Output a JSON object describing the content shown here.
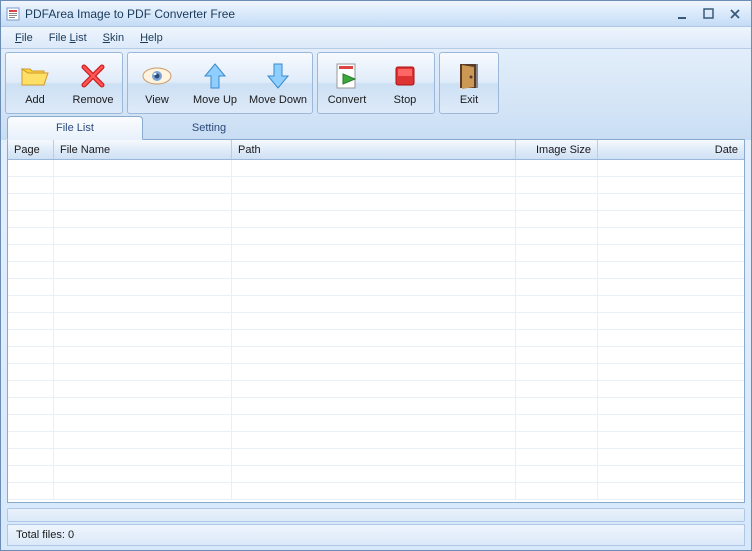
{
  "window": {
    "title": "PDFArea Image to PDF Converter Free"
  },
  "menu": {
    "file": "File",
    "filelist": "File List",
    "skin": "Skin",
    "help": "Help"
  },
  "toolbar": {
    "add": "Add",
    "remove": "Remove",
    "view": "View",
    "moveup": "Move Up",
    "movedown": "Move Down",
    "convert": "Convert",
    "stop": "Stop",
    "exit": "Exit"
  },
  "tabs": {
    "filelist": "File List",
    "setting": "Setting"
  },
  "columns": {
    "page": "Page",
    "filename": "File Name",
    "path": "Path",
    "imagesize": "Image Size",
    "date": "Date"
  },
  "status": {
    "total": "Total files: 0"
  }
}
